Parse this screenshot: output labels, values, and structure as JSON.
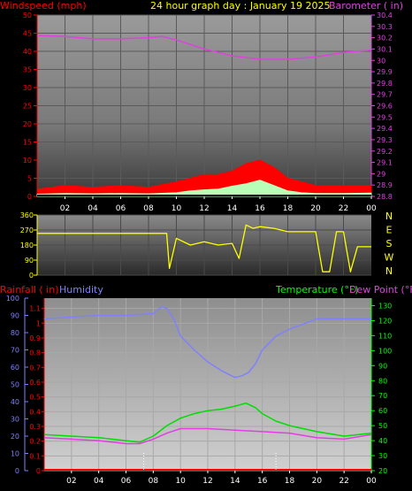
{
  "title": "24 hour graph day : January 19 2025",
  "chart_data": [
    {
      "id": "wind_baro",
      "type": "line",
      "left_label": "Windspeed (mph)",
      "right_label": "Barometer ( in)",
      "left_ticks": [
        "0",
        "5",
        "10",
        "15",
        "20",
        "25",
        "30",
        "35",
        "40",
        "45",
        "50"
      ],
      "right_ticks": [
        "28.8",
        "28.9",
        "29",
        "29.1",
        "29.2",
        "29.3",
        "29.4",
        "29.5",
        "29.6",
        "29.7",
        "29.8",
        "29.9",
        "30",
        "30.1",
        "30.2",
        "30.3",
        "30.4"
      ],
      "x_ticks": [
        "02",
        "04",
        "06",
        "08",
        "10",
        "12",
        "14",
        "16",
        "18",
        "20",
        "22",
        "00"
      ],
      "left_ylim": [
        0,
        50
      ],
      "right_ylim": [
        28.8,
        30.4
      ],
      "series": [
        {
          "color": "#e040e0",
          "axis": "right",
          "x": [
            0,
            2,
            4,
            6,
            8,
            9,
            10,
            12,
            14,
            16,
            18,
            20,
            22,
            24
          ],
          "values": [
            30.22,
            30.21,
            30.19,
            30.19,
            30.2,
            30.21,
            30.18,
            30.1,
            30.04,
            30.01,
            30.01,
            30.03,
            30.07,
            30.09
          ]
        },
        {
          "color": "#ff0000",
          "axis": "left",
          "x": [
            0,
            2,
            4,
            6,
            8,
            10,
            11,
            12,
            13,
            14,
            15,
            16,
            17,
            18,
            19,
            20,
            22,
            24
          ],
          "values": [
            2,
            3,
            2.5,
            3,
            2.5,
            4,
            5,
            6,
            6,
            7,
            9,
            10,
            8,
            5,
            4,
            3,
            3,
            3
          ]
        },
        {
          "color": "#b8ffb8",
          "axis": "left",
          "x": [
            0,
            2,
            4,
            6,
            8,
            10,
            11,
            12,
            13,
            14,
            15,
            16,
            17,
            18,
            19,
            20,
            22,
            24
          ],
          "values": [
            0.6,
            0.8,
            0.7,
            0.8,
            0.7,
            1.0,
            1.5,
            1.8,
            2.0,
            2.8,
            3.5,
            4.5,
            3.0,
            1.5,
            1.0,
            0.8,
            0.8,
            0.9
          ]
        }
      ]
    },
    {
      "id": "direction",
      "type": "line",
      "left_ticks": [
        "0",
        "90",
        "180",
        "270",
        "360"
      ],
      "right_ticks": [
        "N",
        "W",
        "S",
        "E",
        "N"
      ],
      "ylim": [
        0,
        360
      ],
      "series": [
        {
          "color": "#ffff00",
          "x": [
            0,
            9.3,
            9.5,
            10,
            11,
            12,
            13,
            14,
            14.5,
            15,
            15.5,
            16,
            17,
            18,
            19,
            20,
            20.5,
            21,
            21.5,
            22,
            22.5,
            23,
            24
          ],
          "values": [
            250,
            250,
            40,
            220,
            180,
            200,
            180,
            190,
            100,
            300,
            280,
            290,
            280,
            260,
            260,
            260,
            20,
            20,
            260,
            260,
            20,
            170,
            170
          ]
        }
      ]
    },
    {
      "id": "rain_hum_temp",
      "type": "line",
      "left_label_1": "Rainfall ( in)",
      "left_label_2": "Humidity",
      "right_label_1": "Temperature (°F)",
      "right_label_2": "Dew Point (°F)",
      "rain_ticks": [
        "0",
        "0.1",
        "0.2",
        "0.3",
        "0.4",
        "0.5",
        "0.6",
        "0.7",
        "0.8",
        "0.9",
        "1",
        "1.1"
      ],
      "hum_ticks": [
        "0",
        "10",
        "20",
        "30",
        "40",
        "50",
        "60",
        "70",
        "80",
        "90",
        "100"
      ],
      "temp_ticks": [
        "20",
        "30",
        "40",
        "50",
        "60",
        "70",
        "80",
        "90",
        "100",
        "110",
        "120",
        "130"
      ],
      "x_ticks": [
        "02",
        "04",
        "06",
        "08",
        "10",
        "12",
        "14",
        "16",
        "18",
        "20",
        "22",
        "00"
      ],
      "hum_ylim": [
        0,
        100
      ],
      "temp_ylim": [
        20,
        135
      ],
      "series": [
        {
          "color": "#8080ff",
          "axis": "hum",
          "x": [
            0,
            2,
            4,
            6,
            8,
            8.6,
            9,
            9.5,
            10,
            11,
            12,
            13,
            14,
            14.5,
            15,
            15.5,
            16,
            17,
            18,
            19,
            20,
            22,
            24
          ],
          "values": [
            88,
            89,
            90,
            90,
            91,
            95,
            94,
            88,
            78,
            70,
            63,
            58,
            54,
            55,
            57,
            62,
            70,
            78,
            82,
            85,
            88,
            88,
            88
          ]
        },
        {
          "color": "#00dd00",
          "axis": "temp",
          "x": [
            0,
            2,
            4,
            6,
            7,
            8,
            9,
            10,
            11,
            12,
            13,
            14,
            14.8,
            15.5,
            16,
            17,
            18,
            20,
            22,
            24
          ],
          "values": [
            44,
            43,
            42,
            40,
            39,
            43,
            50,
            55,
            58,
            60,
            61,
            63,
            65,
            62,
            58,
            53,
            50,
            46,
            43,
            45
          ]
        },
        {
          "color": "#e040e0",
          "axis": "temp",
          "x": [
            0,
            2,
            4,
            6,
            7,
            8,
            9,
            10,
            11,
            12,
            14,
            16,
            18,
            20,
            22,
            24
          ],
          "values": [
            42,
            41,
            40,
            38,
            38,
            41,
            45,
            48,
            48,
            48,
            47,
            46,
            45,
            42,
            41,
            44
          ]
        },
        {
          "color": "#ff0000",
          "axis": "rain",
          "x": [
            0,
            24
          ],
          "values": [
            0,
            0
          ]
        }
      ]
    }
  ]
}
